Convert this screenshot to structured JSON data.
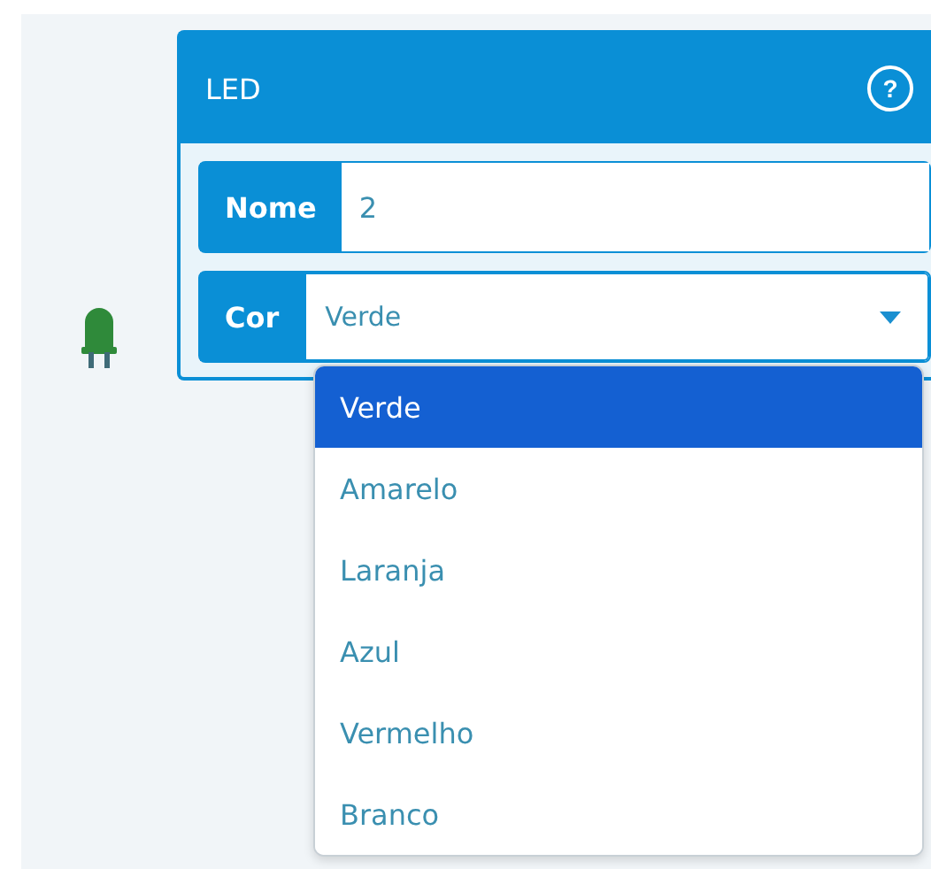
{
  "panel": {
    "title": "LED",
    "help": "?"
  },
  "fields": [
    {
      "kind": "text",
      "label": "Nome",
      "value": "2"
    },
    {
      "kind": "select",
      "label": "Cor",
      "value": "Verde",
      "expanded": true,
      "options": [
        {
          "label": "Verde",
          "selected": true
        },
        {
          "label": "Amarelo",
          "selected": false
        },
        {
          "label": "Laranja",
          "selected": false
        },
        {
          "label": "Azul",
          "selected": false
        },
        {
          "label": "Vermelho",
          "selected": false
        },
        {
          "label": "Branco",
          "selected": false
        }
      ]
    }
  ]
}
